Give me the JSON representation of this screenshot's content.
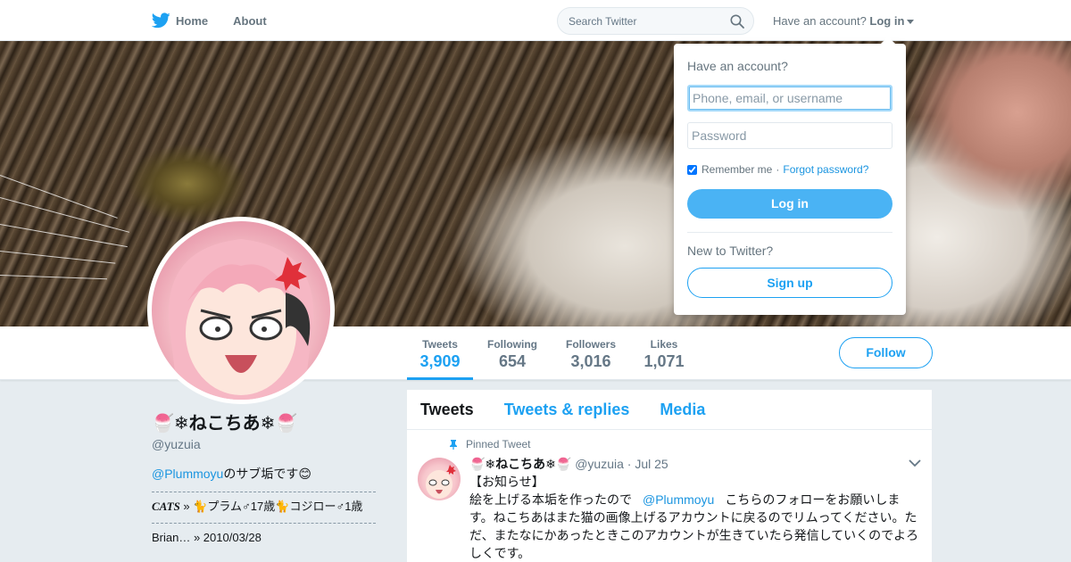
{
  "nav": {
    "home_label": "Home",
    "about_label": "About",
    "search_placeholder": "Search Twitter",
    "account_prompt": "Have an account?",
    "login_label": "Log in"
  },
  "profile": {
    "display_name": "🍧❄ねこちあ❄🍧",
    "handle": "@yuzuia",
    "bio_mention": "@Plummoyu",
    "bio_rest": "のサブ垢です😊",
    "cats_label": "CATS",
    "cats_text": " » 🐈プラム♂17歳🐈コジロー♂1歳",
    "next_line": "Brian… » 2010/03/28"
  },
  "stats": [
    {
      "label": "Tweets",
      "value": "3,909"
    },
    {
      "label": "Following",
      "value": "654"
    },
    {
      "label": "Followers",
      "value": "3,016"
    },
    {
      "label": "Likes",
      "value": "1,071"
    }
  ],
  "follow_label": "Follow",
  "timeline": {
    "tabs": [
      "Tweets",
      "Tweets & replies",
      "Media"
    ],
    "pinned_label": "Pinned Tweet",
    "tweet": {
      "name": "🍧❄ねこちあ❄🍧",
      "handle": "@yuzuia",
      "date": "· Jul 25",
      "line1": "【お知らせ】",
      "line2_pre": "絵を上げる本垢を作ったので",
      "line2_mention": "@Plummoyu",
      "line2_post": "こちらのフォローをお願いします。ねこちあはまた猫の画像上げるアカウントに戻るのでリムってください。ただ、またなにかあったときこのアカウントが生きていたら発信していくのでよろしくです。"
    }
  },
  "login_dropdown": {
    "title": "Have an account?",
    "username_placeholder": "Phone, email, or username",
    "password_placeholder": "Password",
    "remember_label": "Remember me",
    "separator": "·",
    "forgot_label": "Forgot password?",
    "login_button": "Log in",
    "new_prompt": "New to Twitter?",
    "signup_button": "Sign up"
  },
  "colors": {
    "accent": "#1da1f2",
    "login_button_bg": "#4ab3f4",
    "page_bg": "#e6ecf0"
  }
}
